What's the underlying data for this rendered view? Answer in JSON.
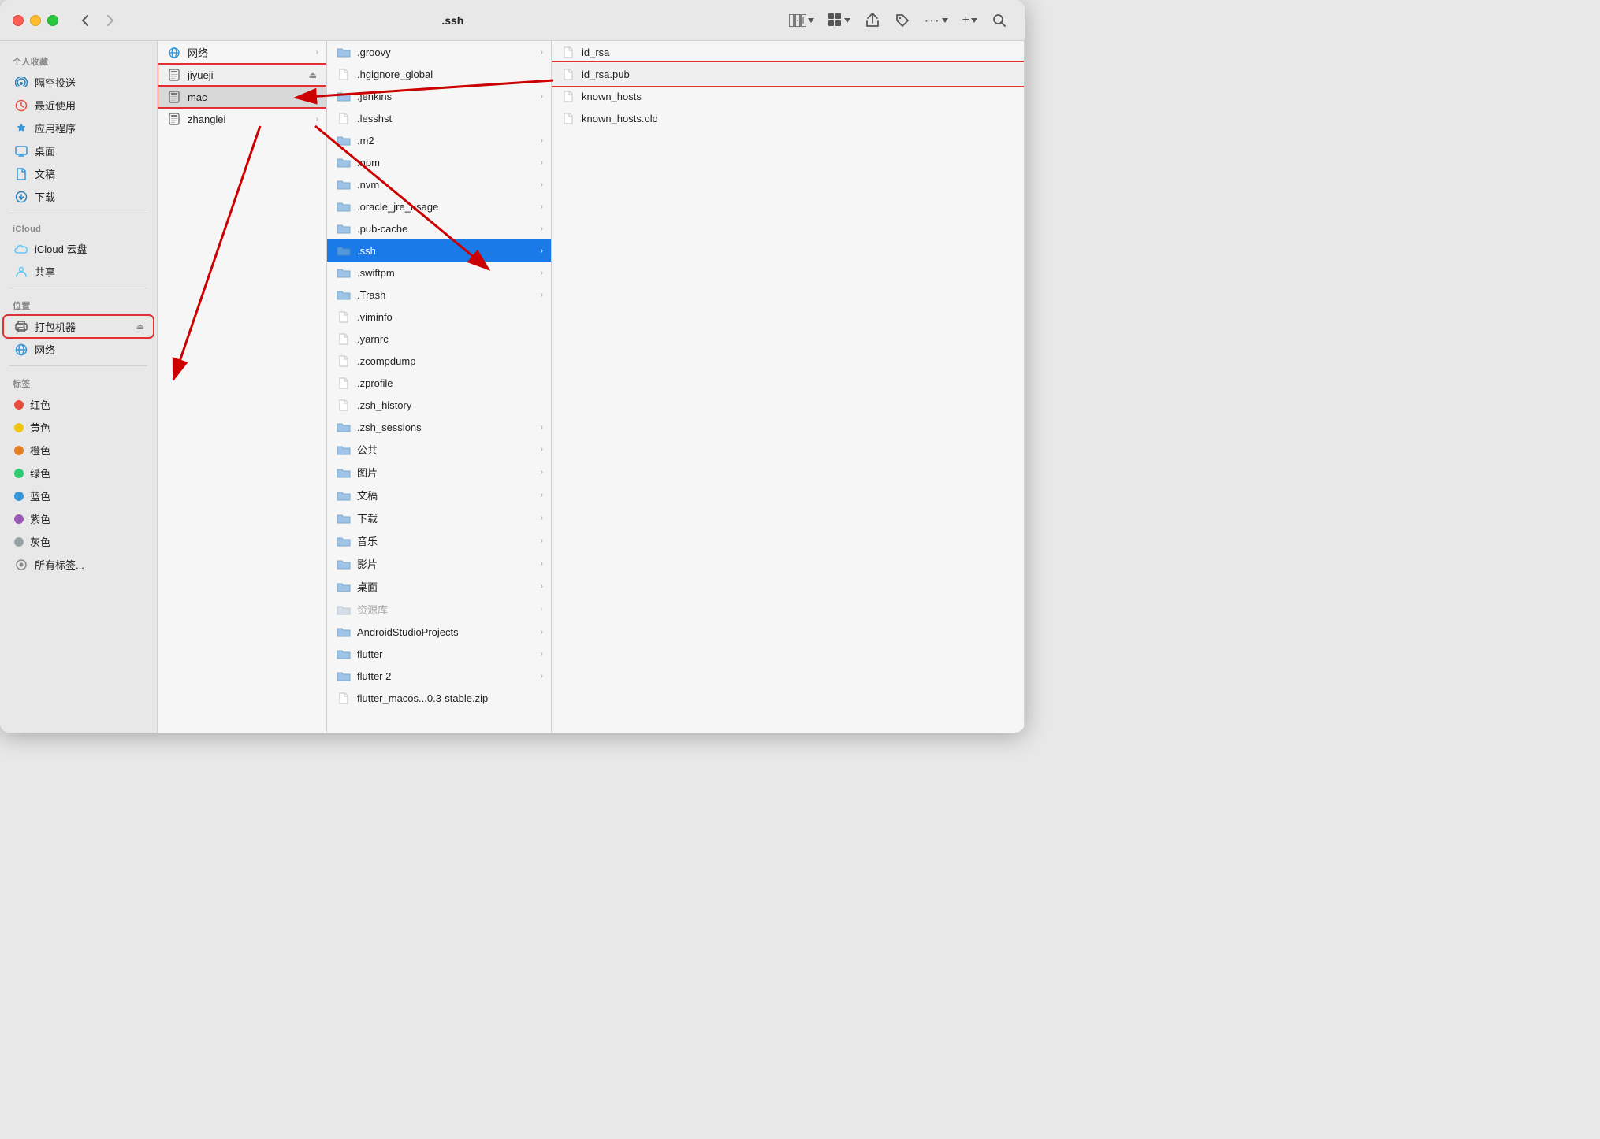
{
  "window": {
    "title": ".ssh"
  },
  "titlebar": {
    "back_label": "‹",
    "forward_label": "›",
    "view_icon": "⊞",
    "share_icon": "↑",
    "tag_icon": "◇",
    "more_icon": "···",
    "add_icon": "+",
    "search_icon": "⌕"
  },
  "sidebar": {
    "personal_section": "个人收藏",
    "icloud_section": "iCloud",
    "locations_section": "位置",
    "tags_section": "标签",
    "personal_items": [
      {
        "id": "airdrop",
        "label": "隔空投送",
        "icon": "wifi",
        "color": "#2980b9"
      },
      {
        "id": "recents",
        "label": "最近使用",
        "icon": "clock",
        "color": "#e74c3c"
      },
      {
        "id": "apps",
        "label": "应用程序",
        "icon": "rocket",
        "color": "#3498db"
      },
      {
        "id": "desktop",
        "label": "桌面",
        "icon": "monitor",
        "color": "#3498db"
      },
      {
        "id": "documents",
        "label": "文稿",
        "icon": "doc",
        "color": "#3498db"
      },
      {
        "id": "downloads",
        "label": "下载",
        "icon": "download",
        "color": "#2980b9"
      }
    ],
    "icloud_items": [
      {
        "id": "icloud-drive",
        "label": "iCloud 云盘",
        "icon": "cloud",
        "color": "#5ac8fa"
      },
      {
        "id": "shared",
        "label": "共享",
        "icon": "share",
        "color": "#5ac8fa"
      }
    ],
    "location_items": [
      {
        "id": "printer",
        "label": "打包机器",
        "icon": "printer",
        "color": "#555",
        "eject": true,
        "highlighted": true
      },
      {
        "id": "network",
        "label": "网络",
        "icon": "globe",
        "color": "#3498db"
      }
    ],
    "tag_items": [
      {
        "id": "red",
        "label": "红色",
        "color": "#e74c3c"
      },
      {
        "id": "yellow",
        "label": "黄色",
        "color": "#f1c40f"
      },
      {
        "id": "orange",
        "label": "橙色",
        "color": "#e67e22"
      },
      {
        "id": "green",
        "label": "绿色",
        "color": "#2ecc71"
      },
      {
        "id": "blue",
        "label": "蓝色",
        "color": "#3498db"
      },
      {
        "id": "purple",
        "label": "紫色",
        "color": "#9b59b6"
      },
      {
        "id": "gray",
        "label": "灰色",
        "color": "#95a5a6"
      },
      {
        "id": "all-tags",
        "label": "所有标签...",
        "color": null
      }
    ]
  },
  "columns": {
    "col1_items": [
      {
        "id": "network",
        "label": "网络",
        "icon": "globe",
        "has_chevron": true
      },
      {
        "id": "jiyueji",
        "label": "jiyueji",
        "icon": "mac",
        "has_chevron": false,
        "eject": true,
        "highlighted": true
      },
      {
        "id": "mac",
        "label": "mac",
        "icon": "mac",
        "has_chevron": false,
        "eject": true,
        "active": true,
        "highlighted": true
      },
      {
        "id": "zhanglei",
        "label": "zhanglei",
        "icon": "mac",
        "has_chevron": true
      }
    ],
    "col2_items": [
      {
        "id": "groovy",
        "label": ".groovy",
        "icon": "folder",
        "has_chevron": true
      },
      {
        "id": "hgignore",
        "label": ".hgignore_global",
        "icon": "file",
        "has_chevron": false
      },
      {
        "id": "jenkins",
        "label": ".jenkins",
        "icon": "folder",
        "has_chevron": true
      },
      {
        "id": "lesshst",
        "label": ".lesshst",
        "icon": "file",
        "has_chevron": false
      },
      {
        "id": "m2",
        "label": ".m2",
        "icon": "folder",
        "has_chevron": true
      },
      {
        "id": "npm",
        "label": ".npm",
        "icon": "folder",
        "has_chevron": true
      },
      {
        "id": "nvm",
        "label": ".nvm",
        "icon": "folder",
        "has_chevron": true
      },
      {
        "id": "oracle",
        "label": ".oracle_jre_usage",
        "icon": "folder",
        "has_chevron": true
      },
      {
        "id": "pub-cache",
        "label": ".pub-cache",
        "icon": "folder",
        "has_chevron": true
      },
      {
        "id": "ssh",
        "label": ".ssh",
        "icon": "folder",
        "has_chevron": true,
        "selected": true
      },
      {
        "id": "swiftpm",
        "label": ".swiftpm",
        "icon": "folder",
        "has_chevron": true
      },
      {
        "id": "trash",
        "label": ".Trash",
        "icon": "folder",
        "has_chevron": true
      },
      {
        "id": "viminfo",
        "label": ".viminfo",
        "icon": "file",
        "has_chevron": false
      },
      {
        "id": "yarnrc",
        "label": ".yarnrc",
        "icon": "file",
        "has_chevron": false
      },
      {
        "id": "zcompdump",
        "label": ".zcompdump",
        "icon": "file",
        "has_chevron": false
      },
      {
        "id": "zprofile",
        "label": ".zprofile",
        "icon": "file",
        "has_chevron": false
      },
      {
        "id": "zsh_history",
        "label": ".zsh_history",
        "icon": "file",
        "has_chevron": false
      },
      {
        "id": "zsh_sessions",
        "label": ".zsh_sessions",
        "icon": "folder",
        "has_chevron": true
      },
      {
        "id": "public",
        "label": "公共",
        "icon": "folder",
        "has_chevron": true
      },
      {
        "id": "pictures",
        "label": "图片",
        "icon": "folder",
        "has_chevron": true
      },
      {
        "id": "documents",
        "label": "文稿",
        "icon": "folder",
        "has_chevron": true
      },
      {
        "id": "downloads",
        "label": "下载",
        "icon": "folder",
        "has_chevron": true
      },
      {
        "id": "music",
        "label": "音乐",
        "icon": "folder",
        "has_chevron": true
      },
      {
        "id": "movies",
        "label": "影片",
        "icon": "folder",
        "has_chevron": true
      },
      {
        "id": "desktop",
        "label": "桌面",
        "icon": "folder",
        "has_chevron": true
      },
      {
        "id": "library",
        "label": "资源库",
        "icon": "folder",
        "has_chevron": true,
        "dimmed": true
      },
      {
        "id": "androidstudio",
        "label": "AndroidStudioProjects",
        "icon": "folder",
        "has_chevron": true
      },
      {
        "id": "flutter",
        "label": "flutter",
        "icon": "folder",
        "has_chevron": true
      },
      {
        "id": "flutter2",
        "label": "flutter 2",
        "icon": "folder",
        "has_chevron": true
      },
      {
        "id": "flutter-macos",
        "label": "flutter_macos...0.3-stable.zip",
        "icon": "file",
        "has_chevron": false
      }
    ],
    "col3_items": [
      {
        "id": "id_rsa",
        "label": "id_rsa",
        "icon": "file",
        "has_chevron": false
      },
      {
        "id": "id_rsa_pub",
        "label": "id_rsa.pub",
        "icon": "file",
        "has_chevron": false,
        "highlighted": true
      },
      {
        "id": "known_hosts",
        "label": "known_hosts",
        "icon": "file",
        "has_chevron": false
      },
      {
        "id": "known_hosts_old",
        "label": "known_hosts.old",
        "icon": "file",
        "has_chevron": false
      }
    ]
  }
}
